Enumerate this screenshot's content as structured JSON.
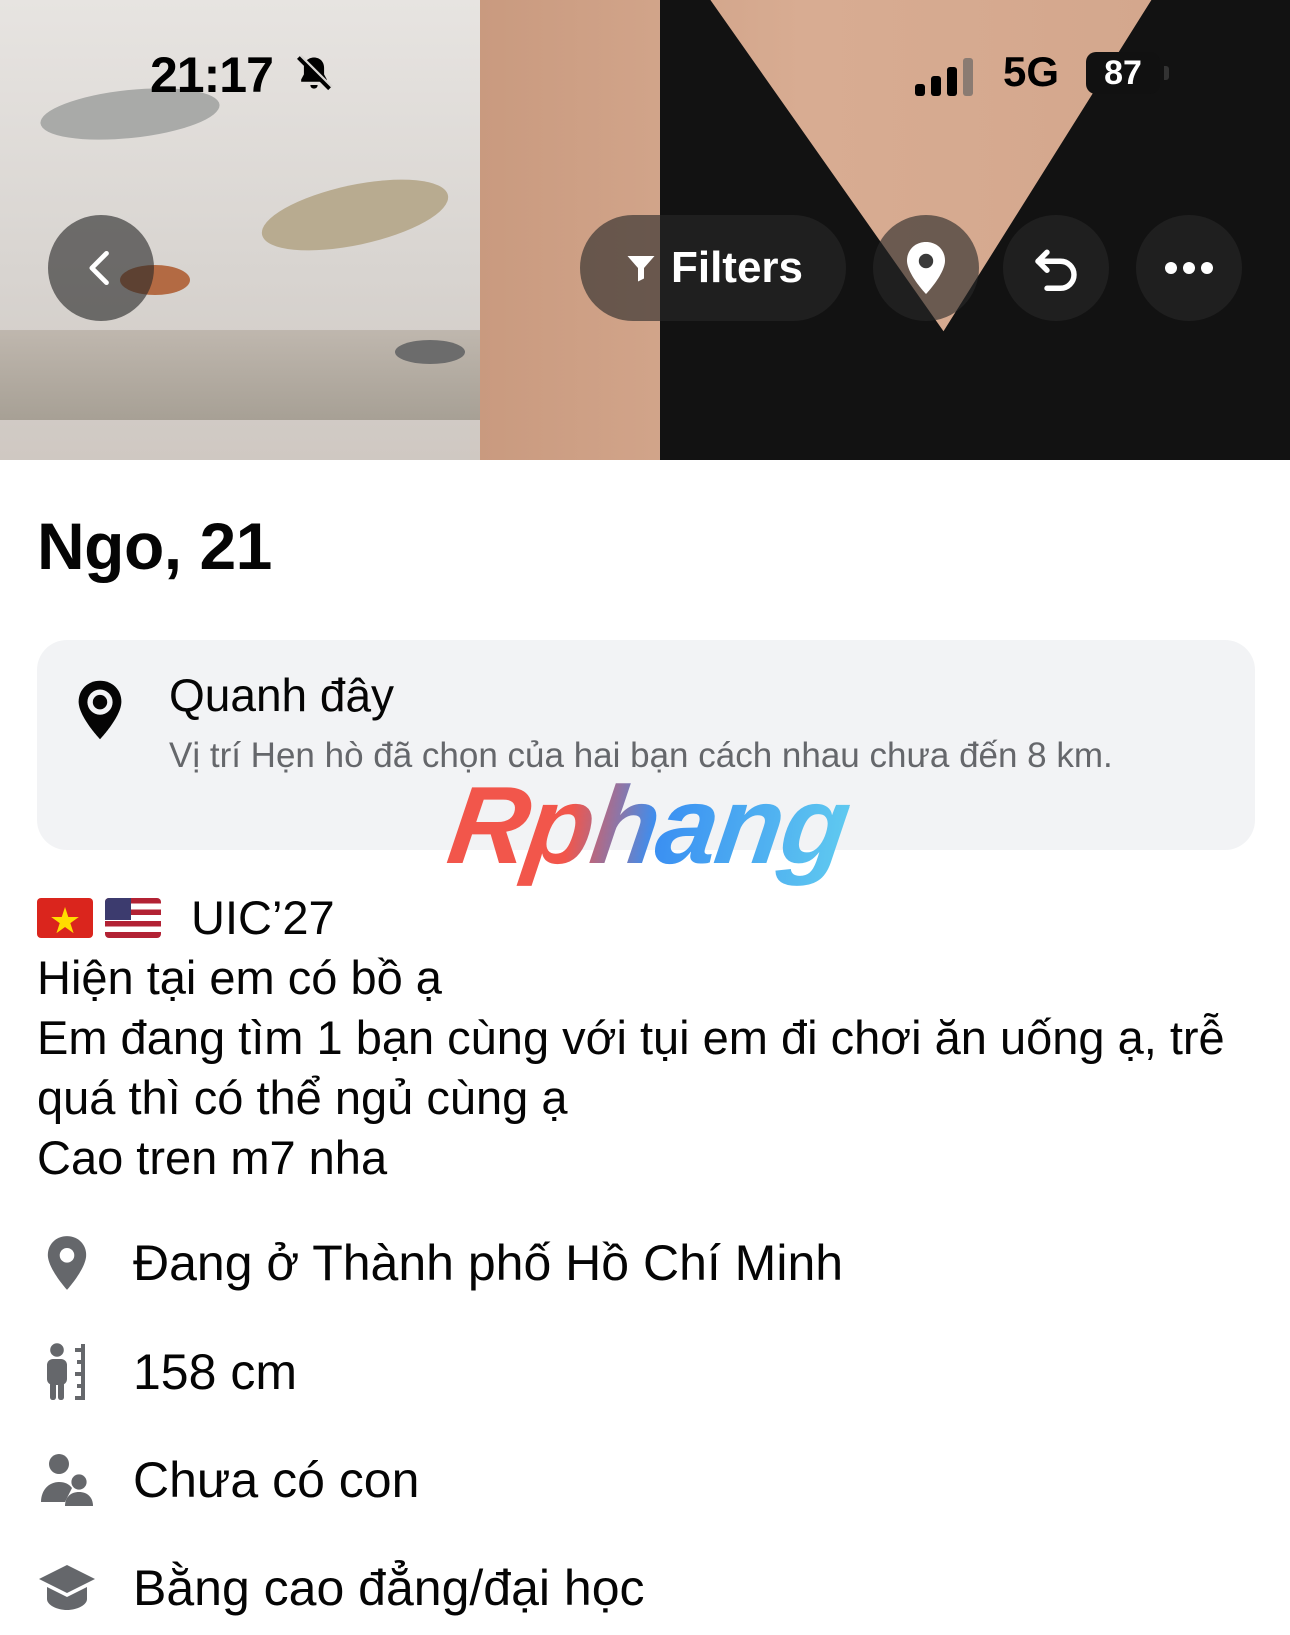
{
  "status_bar": {
    "time": "21:17",
    "network": "5G",
    "battery": "87"
  },
  "nav": {
    "filters_label": "Filters"
  },
  "profile": {
    "name_age": "Ngo, 21",
    "location_card": {
      "title": "Quanh đây",
      "subtitle": "Vị trí Hẹn hò đã chọn của hai bạn cách nhau chưa đến 8 km."
    },
    "bio": {
      "flags_suffix": "UIC’27",
      "lines": [
        "Hiện tại em có bồ ạ",
        "Em đang tìm 1 bạn cùng với tụi em đi chơi ăn uống ạ, trễ quá thì có thể ngủ cùng ạ",
        "Cao tren m7 nha"
      ]
    },
    "details": [
      {
        "icon": "location-pin-icon",
        "text": "Đang ở Thành phố Hồ Chí Minh"
      },
      {
        "icon": "height-icon",
        "text": "158 cm"
      },
      {
        "icon": "children-icon",
        "text": "Chưa có con"
      },
      {
        "icon": "education-icon",
        "text": "Bằng cao đẳng/đại học"
      }
    ]
  },
  "watermark": "Rphang",
  "colors": {
    "card_bg": "#f2f3f5",
    "secondary_text": "#65676b",
    "icon_gray": "#65676b"
  }
}
